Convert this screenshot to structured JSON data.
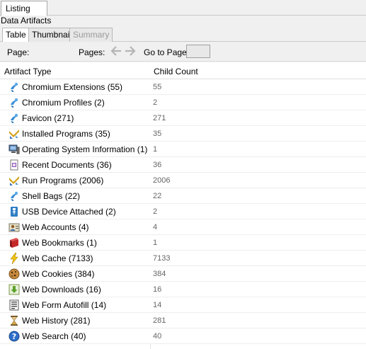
{
  "top_tab": "Listing",
  "section_title": "Data Artifacts",
  "sub_tabs": [
    "Table",
    "Thumbnail",
    "Summary"
  ],
  "toolbar": {
    "page_label": "Page:",
    "pages_label": "Pages:",
    "goto_label": "Go to Page:",
    "goto_value": ""
  },
  "columns": [
    "Artifact Type",
    "Child Count"
  ],
  "rows": [
    {
      "label": "Chromium Extensions (55)",
      "count": "55",
      "icon": "chromium-icon"
    },
    {
      "label": "Chromium Profiles (2)",
      "count": "2",
      "icon": "chromium-icon"
    },
    {
      "label": "Favicon (271)",
      "count": "271",
      "icon": "chromium-icon"
    },
    {
      "label": "Installed Programs (35)",
      "count": "35",
      "icon": "programs-icon"
    },
    {
      "label": "Operating System Information (1)",
      "count": "1",
      "icon": "computer-icon"
    },
    {
      "label": "Recent Documents (36)",
      "count": "36",
      "icon": "document-icon"
    },
    {
      "label": "Run Programs (2006)",
      "count": "2006",
      "icon": "programs-icon"
    },
    {
      "label": "Shell Bags (22)",
      "count": "22",
      "icon": "chromium-icon"
    },
    {
      "label": "USB Device Attached (2)",
      "count": "2",
      "icon": "usb-icon"
    },
    {
      "label": "Web Accounts (4)",
      "count": "4",
      "icon": "account-icon"
    },
    {
      "label": "Web Bookmarks (1)",
      "count": "1",
      "icon": "bookmark-icon"
    },
    {
      "label": "Web Cache (7133)",
      "count": "7133",
      "icon": "lightning-icon"
    },
    {
      "label": "Web Cookies (384)",
      "count": "384",
      "icon": "cookie-icon"
    },
    {
      "label": "Web Downloads (16)",
      "count": "16",
      "icon": "download-icon"
    },
    {
      "label": "Web Form Autofill (14)",
      "count": "14",
      "icon": "form-icon"
    },
    {
      "label": "Web History (281)",
      "count": "281",
      "icon": "hourglass-icon"
    },
    {
      "label": "Web Search (40)",
      "count": "40",
      "icon": "search-globe-icon"
    }
  ]
}
